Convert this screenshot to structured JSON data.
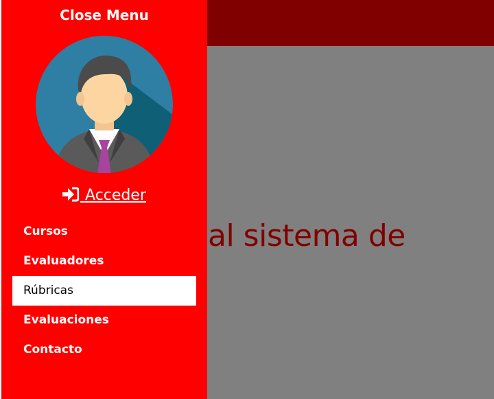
{
  "sidebar": {
    "close_label": "Close Menu",
    "login_label": " Acceder",
    "login_icon": "sign-in-icon",
    "items": [
      {
        "label": "Cursos",
        "active": false
      },
      {
        "label": "Evaluadores",
        "active": false
      },
      {
        "label": "Rúbricas",
        "active": true
      },
      {
        "label": "Evaluaciones",
        "active": false
      },
      {
        "label": "Contacto",
        "active": false
      }
    ]
  },
  "main": {
    "heading": "al sistema de"
  },
  "colors": {
    "sidebar_bg": "#ff0000",
    "topbar_bg": "#800000",
    "content_bg": "#808080",
    "heading_color": "#800000",
    "active_item_bg": "#ffffff"
  }
}
